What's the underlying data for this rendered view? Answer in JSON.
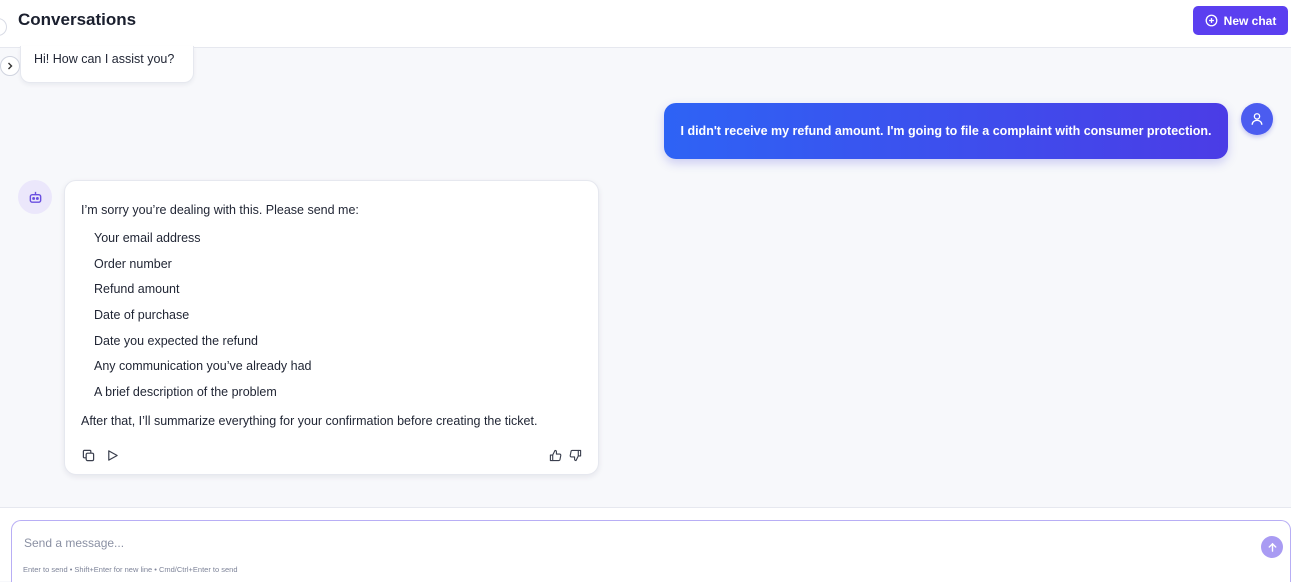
{
  "header": {
    "title": "Conversations",
    "new_chat_label": "New chat"
  },
  "messages": {
    "greeting": "Hi! How can I assist you?",
    "user_message": "I didn't receive my refund amount. I'm going to file a complaint with consumer protection.",
    "bot_intro": "I’m sorry you’re dealing with this. Please send me:",
    "bot_items": [
      "Your email address",
      "Order number",
      "Refund amount",
      "Date of purchase",
      "Date you expected the refund",
      "Any communication you’ve already had",
      "A brief description of the problem"
    ],
    "bot_outro": "After that, I’ll summarize everything for your confirmation before creating the ticket."
  },
  "composer": {
    "placeholder": "Send a message...",
    "hint": "Enter to send • Shift+Enter for new line • Cmd/Ctrl+Enter to send"
  },
  "icons": {
    "new_chat": "plus-circle-icon",
    "sidebar_toggle": "chevron-right-icon",
    "user_avatar": "user-icon",
    "bot_avatar": "robot-icon",
    "copy": "copy-icon",
    "play": "play-icon",
    "thumbs_up": "thumbs-up-icon",
    "thumbs_down": "thumbs-down-icon",
    "send": "arrow-up-icon"
  },
  "colors": {
    "accent": "#5b3ff0",
    "user_bubble_start": "#2e63f5",
    "user_bubble_end": "#4b3ce6",
    "send_button": "#a99bf3"
  }
}
